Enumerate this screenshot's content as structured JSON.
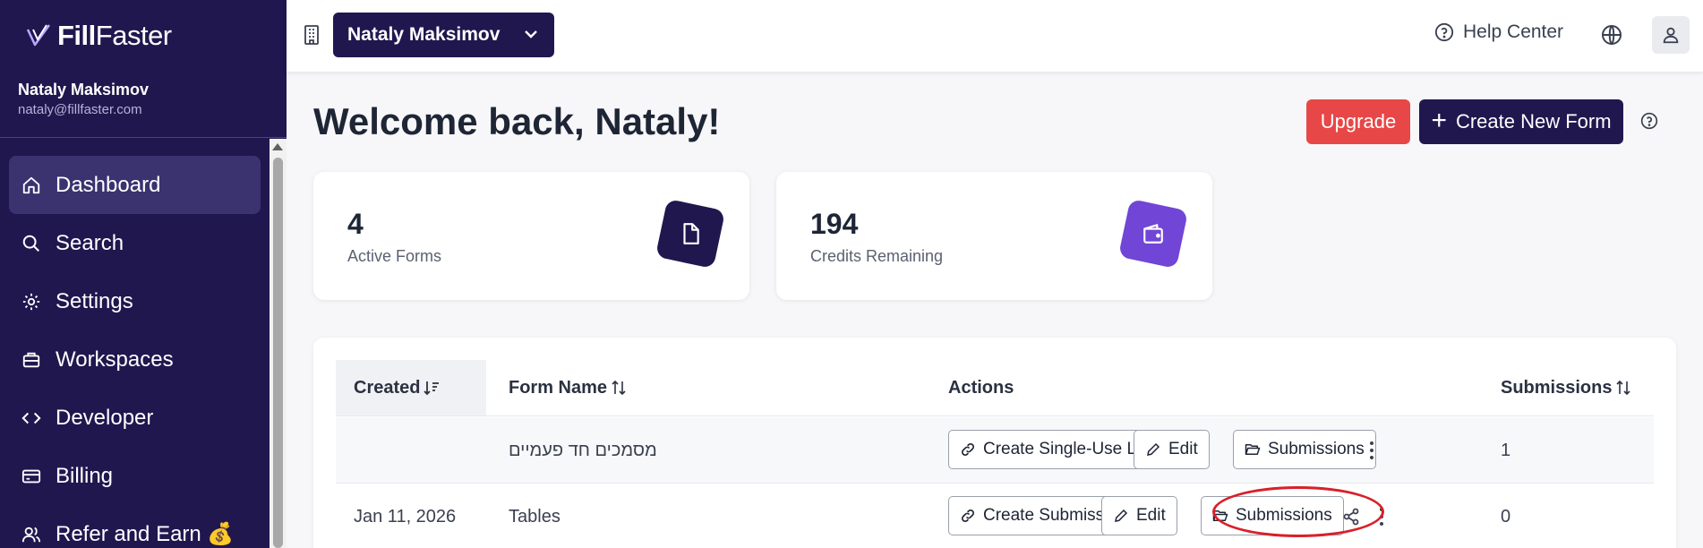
{
  "app": {
    "logo_strong": "Fill",
    "logo_light": "Faster",
    "brand_color": "#21174f",
    "accent_purple": "#7145d6",
    "danger_color": "#e84747"
  },
  "user": {
    "name": "Nataly Maksimov",
    "email": "nataly@fillfaster.com"
  },
  "sidebar": {
    "items": [
      {
        "label": "Dashboard",
        "icon": "home-icon",
        "active": true
      },
      {
        "label": "Search",
        "icon": "search-icon"
      },
      {
        "label": "Settings",
        "icon": "gear-icon"
      },
      {
        "label": "Workspaces",
        "icon": "briefcase-icon"
      },
      {
        "label": "Developer",
        "icon": "code-icon"
      },
      {
        "label": "Billing",
        "icon": "credit-card-icon"
      },
      {
        "label": "Refer and Earn 💰",
        "icon": "users-icon"
      }
    ]
  },
  "topbar": {
    "workspace": "Nataly Maksimov",
    "help_label": "Help Center"
  },
  "main": {
    "welcome": "Welcome back, Nataly!",
    "upgrade_label": "Upgrade",
    "create_label": "Create New Form",
    "stats": [
      {
        "value": "4",
        "label": "Active Forms",
        "icon": "file-icon"
      },
      {
        "value": "194",
        "label": "Credits Remaining",
        "icon": "wallet-icon"
      }
    ]
  },
  "table": {
    "columns": [
      "Created",
      "Form Name",
      "Actions",
      "Submissions"
    ],
    "rows": [
      {
        "created": "",
        "form_name": "מסמכים חד פעמיים",
        "actions": [
          "Create Single-Use Link",
          "Edit",
          "Submissions"
        ],
        "submissions": "1"
      },
      {
        "created": "Jan 11, 2026",
        "form_name": "Tables",
        "actions": [
          "Create Submission",
          "Edit",
          "Submissions"
        ],
        "submissions": "0"
      }
    ]
  }
}
